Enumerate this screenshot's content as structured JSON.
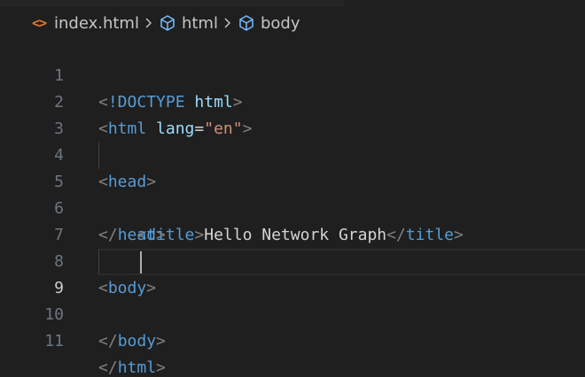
{
  "breadcrumb": {
    "file": "index.html",
    "file_icon": "html-file-icon",
    "items": [
      "html",
      "body"
    ],
    "item_icon": "cube-icon",
    "separator_icon": "chevron-right-icon"
  },
  "editor": {
    "current_line": "9",
    "line_numbers": [
      "1",
      "2",
      "3",
      "4",
      "5",
      "6",
      "7",
      "8",
      "9",
      "10",
      "11"
    ],
    "tokens": {
      "lt": "<",
      "gt": ">",
      "lt_slash": "</",
      "doctype_kw": "!DOCTYPE",
      "html": "html",
      "lang_attr": "lang",
      "eq": "=",
      "lang_value": "\"en\"",
      "head": "head",
      "title": "title",
      "title_text": "Hello Network Graph",
      "body": "body"
    }
  },
  "colors": {
    "background": "#1f1f1f",
    "tag": "#569cd6",
    "attribute": "#9cdcfe",
    "string": "#ce9178",
    "punctuation": "#808080",
    "text": "#d4d4d4",
    "line_number": "#6e7681",
    "file_icon": "#e37933"
  }
}
